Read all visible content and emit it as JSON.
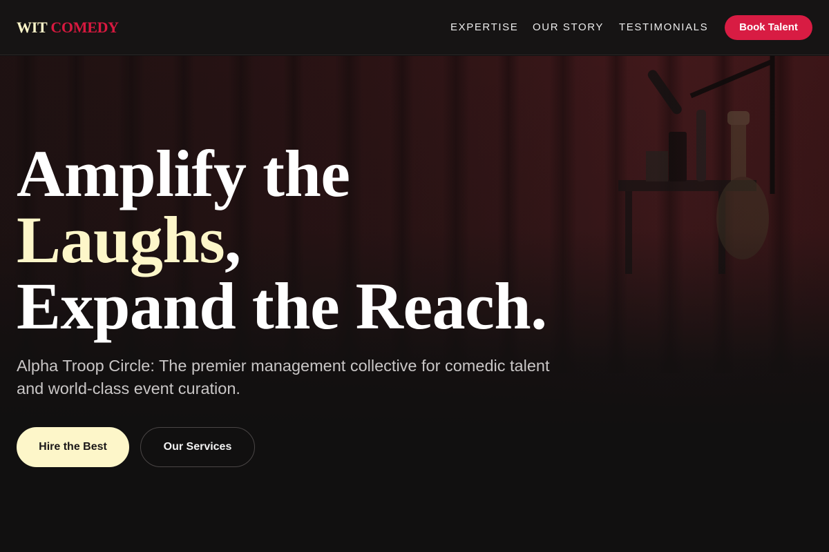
{
  "brand": {
    "name_part1": "WIT",
    "name_part2": "COMEDY"
  },
  "nav": {
    "links": [
      "EXPERTISE",
      "OUR STORY",
      "TESTIMONIALS"
    ],
    "cta_label": "Book Talent"
  },
  "hero": {
    "headline_line1": "Amplify the",
    "headline_accent": "Laughs",
    "headline_comma": ",",
    "headline_line3": "Expand the Reach.",
    "subtitle": "Alpha Troop Circle: The premier management collective for comedic talent and world-class event curation.",
    "primary_button": "Hire the Best",
    "secondary_button": "Our Services"
  },
  "colors": {
    "background": "#111010",
    "accent_cream": "#fdf6c9",
    "accent_red": "#d81c43"
  }
}
